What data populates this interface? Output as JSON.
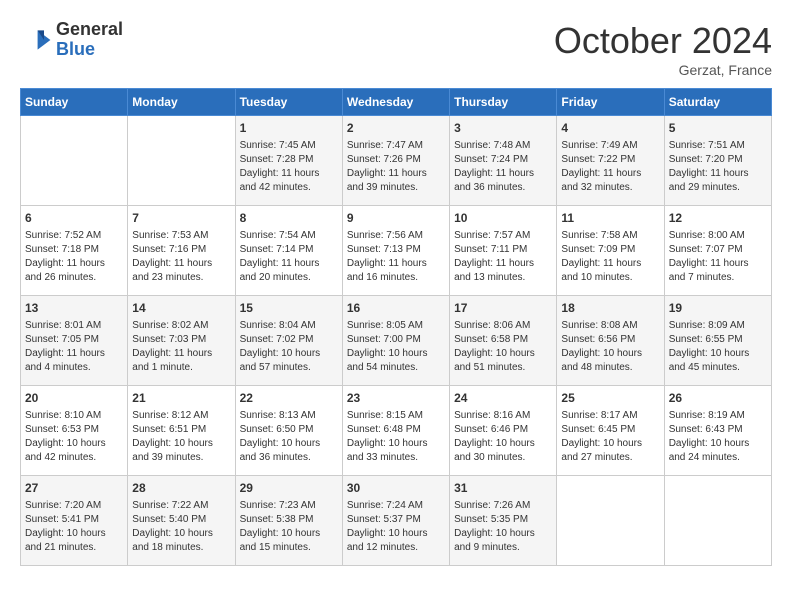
{
  "header": {
    "logo_general": "General",
    "logo_blue": "Blue",
    "month": "October 2024",
    "location": "Gerzat, France"
  },
  "days_of_week": [
    "Sunday",
    "Monday",
    "Tuesday",
    "Wednesday",
    "Thursday",
    "Friday",
    "Saturday"
  ],
  "weeks": [
    [
      {
        "day": "",
        "info": ""
      },
      {
        "day": "",
        "info": ""
      },
      {
        "day": "1",
        "sunrise": "7:45 AM",
        "sunset": "7:28 PM",
        "daylight": "11 hours and 42 minutes."
      },
      {
        "day": "2",
        "sunrise": "7:47 AM",
        "sunset": "7:26 PM",
        "daylight": "11 hours and 39 minutes."
      },
      {
        "day": "3",
        "sunrise": "7:48 AM",
        "sunset": "7:24 PM",
        "daylight": "11 hours and 36 minutes."
      },
      {
        "day": "4",
        "sunrise": "7:49 AM",
        "sunset": "7:22 PM",
        "daylight": "11 hours and 32 minutes."
      },
      {
        "day": "5",
        "sunrise": "7:51 AM",
        "sunset": "7:20 PM",
        "daylight": "11 hours and 29 minutes."
      }
    ],
    [
      {
        "day": "6",
        "sunrise": "7:52 AM",
        "sunset": "7:18 PM",
        "daylight": "11 hours and 26 minutes."
      },
      {
        "day": "7",
        "sunrise": "7:53 AM",
        "sunset": "7:16 PM",
        "daylight": "11 hours and 23 minutes."
      },
      {
        "day": "8",
        "sunrise": "7:54 AM",
        "sunset": "7:14 PM",
        "daylight": "11 hours and 20 minutes."
      },
      {
        "day": "9",
        "sunrise": "7:56 AM",
        "sunset": "7:13 PM",
        "daylight": "11 hours and 16 minutes."
      },
      {
        "day": "10",
        "sunrise": "7:57 AM",
        "sunset": "7:11 PM",
        "daylight": "11 hours and 13 minutes."
      },
      {
        "day": "11",
        "sunrise": "7:58 AM",
        "sunset": "7:09 PM",
        "daylight": "11 hours and 10 minutes."
      },
      {
        "day": "12",
        "sunrise": "8:00 AM",
        "sunset": "7:07 PM",
        "daylight": "11 hours and 7 minutes."
      }
    ],
    [
      {
        "day": "13",
        "sunrise": "8:01 AM",
        "sunset": "7:05 PM",
        "daylight": "11 hours and 4 minutes."
      },
      {
        "day": "14",
        "sunrise": "8:02 AM",
        "sunset": "7:03 PM",
        "daylight": "11 hours and 1 minute."
      },
      {
        "day": "15",
        "sunrise": "8:04 AM",
        "sunset": "7:02 PM",
        "daylight": "10 hours and 57 minutes."
      },
      {
        "day": "16",
        "sunrise": "8:05 AM",
        "sunset": "7:00 PM",
        "daylight": "10 hours and 54 minutes."
      },
      {
        "day": "17",
        "sunrise": "8:06 AM",
        "sunset": "6:58 PM",
        "daylight": "10 hours and 51 minutes."
      },
      {
        "day": "18",
        "sunrise": "8:08 AM",
        "sunset": "6:56 PM",
        "daylight": "10 hours and 48 minutes."
      },
      {
        "day": "19",
        "sunrise": "8:09 AM",
        "sunset": "6:55 PM",
        "daylight": "10 hours and 45 minutes."
      }
    ],
    [
      {
        "day": "20",
        "sunrise": "8:10 AM",
        "sunset": "6:53 PM",
        "daylight": "10 hours and 42 minutes."
      },
      {
        "day": "21",
        "sunrise": "8:12 AM",
        "sunset": "6:51 PM",
        "daylight": "10 hours and 39 minutes."
      },
      {
        "day": "22",
        "sunrise": "8:13 AM",
        "sunset": "6:50 PM",
        "daylight": "10 hours and 36 minutes."
      },
      {
        "day": "23",
        "sunrise": "8:15 AM",
        "sunset": "6:48 PM",
        "daylight": "10 hours and 33 minutes."
      },
      {
        "day": "24",
        "sunrise": "8:16 AM",
        "sunset": "6:46 PM",
        "daylight": "10 hours and 30 minutes."
      },
      {
        "day": "25",
        "sunrise": "8:17 AM",
        "sunset": "6:45 PM",
        "daylight": "10 hours and 27 minutes."
      },
      {
        "day": "26",
        "sunrise": "8:19 AM",
        "sunset": "6:43 PM",
        "daylight": "10 hours and 24 minutes."
      }
    ],
    [
      {
        "day": "27",
        "sunrise": "7:20 AM",
        "sunset": "5:41 PM",
        "daylight": "10 hours and 21 minutes."
      },
      {
        "day": "28",
        "sunrise": "7:22 AM",
        "sunset": "5:40 PM",
        "daylight": "10 hours and 18 minutes."
      },
      {
        "day": "29",
        "sunrise": "7:23 AM",
        "sunset": "5:38 PM",
        "daylight": "10 hours and 15 minutes."
      },
      {
        "day": "30",
        "sunrise": "7:24 AM",
        "sunset": "5:37 PM",
        "daylight": "10 hours and 12 minutes."
      },
      {
        "day": "31",
        "sunrise": "7:26 AM",
        "sunset": "5:35 PM",
        "daylight": "10 hours and 9 minutes."
      },
      {
        "day": "",
        "info": ""
      },
      {
        "day": "",
        "info": ""
      }
    ]
  ]
}
